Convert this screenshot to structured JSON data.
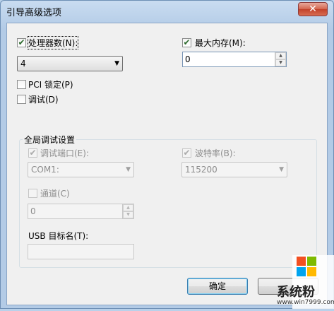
{
  "window": {
    "title": "引导高级选项",
    "close_glyph": "✕"
  },
  "processors": {
    "label": "处理器数(N):",
    "checked": true,
    "value": "4"
  },
  "max_memory": {
    "label": "最大内存(M):",
    "checked": true,
    "value": "0"
  },
  "pci_lock": {
    "label": "PCI 锁定(P)",
    "checked": false
  },
  "debug": {
    "label": "调试(D)",
    "checked": false
  },
  "global_debug": {
    "title": "全局调试设置",
    "debug_port": {
      "label": "调试端口(E):",
      "checked": true,
      "value": "COM1:"
    },
    "baud_rate": {
      "label": "波特率(B):",
      "checked": true,
      "value": "115200"
    },
    "channel": {
      "label": "通道(C)",
      "checked": false,
      "value": "0"
    },
    "usb_target": {
      "label": "USB 目标名(T):",
      "value": ""
    }
  },
  "buttons": {
    "ok": "确定"
  },
  "watermark": {
    "brand": "系统粉",
    "url": "www.win7999.com"
  },
  "colors": {
    "win_red": "#f25022",
    "win_green": "#7fba00",
    "win_blue": "#00a4ef",
    "win_yellow": "#ffb900"
  }
}
